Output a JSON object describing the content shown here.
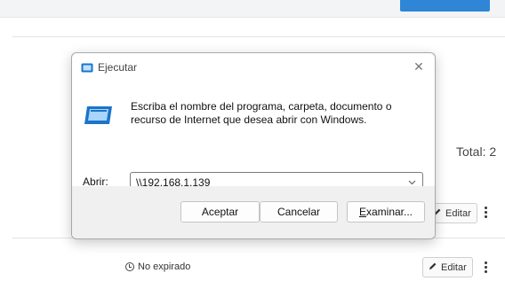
{
  "background": {
    "total_label": "Total: 2",
    "edit_label": "Editar",
    "status_text": "No expirado"
  },
  "dialog": {
    "title": "Ejecutar",
    "description": "Escriba el nombre del programa, carpeta, documento o recurso de Internet que desea abrir con Windows.",
    "open_label_accel": "A",
    "open_label_rest": "brir:",
    "open_value": "\\\\192.168.1.139",
    "ok_label": "Aceptar",
    "cancel_label": "Cancelar",
    "browse_label_accel": "E",
    "browse_label_rest": "xaminar..."
  },
  "colors": {
    "accent": "#2f86d6",
    "icon_blue": "#1a75c8"
  }
}
